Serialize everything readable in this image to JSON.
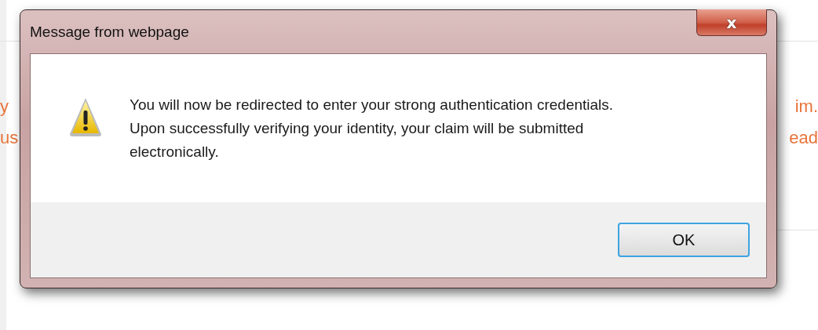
{
  "background": {
    "left_fragments": [
      "y",
      "us"
    ],
    "right_fragments": [
      "im.",
      "ead"
    ]
  },
  "dialog": {
    "title": "Message from webpage",
    "close_label": "x",
    "message": "You will now be redirected to enter your strong authentication credentials. Upon successfully verifying your identity, your claim will be submitted electronically.",
    "buttons": [
      {
        "label": "OK",
        "default": true
      }
    ]
  }
}
